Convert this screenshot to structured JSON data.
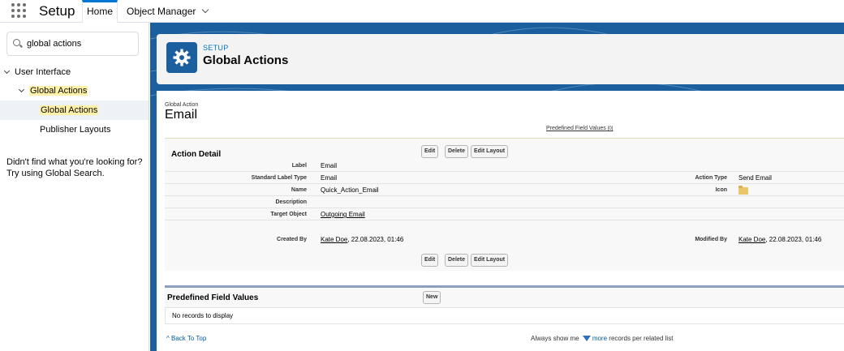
{
  "topbar": {
    "app_name": "Setup",
    "tabs": [
      {
        "label": "Home"
      },
      {
        "label": "Object Manager"
      }
    ]
  },
  "sidebar": {
    "search_value": "global actions",
    "tree": [
      {
        "label": "User Interface"
      },
      {
        "label": "Global Actions"
      },
      {
        "label": "Global Actions"
      },
      {
        "label": "Publisher Layouts"
      }
    ],
    "help_text": "Didn't find what you're looking for? Try using Global Search."
  },
  "header": {
    "eyebrow": "SETUP",
    "title": "Global Actions"
  },
  "record": {
    "type_label": "Global Action",
    "name": "Email",
    "related_link": "Predefined Field Values",
    "related_count": "[0]"
  },
  "action_detail": {
    "title": "Action Detail",
    "buttons": {
      "edit": "Edit",
      "delete": "Delete",
      "edit_layout": "Edit Layout"
    },
    "fields": {
      "label": {
        "label": "Label",
        "value": "Email"
      },
      "standard_label_type": {
        "label": "Standard Label Type",
        "value": "Email"
      },
      "name": {
        "label": "Name",
        "value": "Quick_Action_Email"
      },
      "description": {
        "label": "Description",
        "value": ""
      },
      "target_object": {
        "label": "Target Object",
        "value": "Outgoing Email"
      },
      "action_type": {
        "label": "Action Type",
        "value": "Send Email"
      },
      "icon": {
        "label": "Icon"
      },
      "created_by": {
        "label": "Created By",
        "user": "Kate Doe",
        "date": ", 22.08.2023, 01:46"
      },
      "modified_by": {
        "label": "Modified By",
        "user": "Kate Doe",
        "date": ", 22.08.2023, 01:46"
      }
    }
  },
  "related": {
    "title": "Predefined Field Values",
    "new_button": "New",
    "empty_text": "No records to display"
  },
  "footer": {
    "back_to_top": "Back To Top",
    "always_prefix": "Always show me",
    "more": "more",
    "always_suffix": "records per related list"
  }
}
